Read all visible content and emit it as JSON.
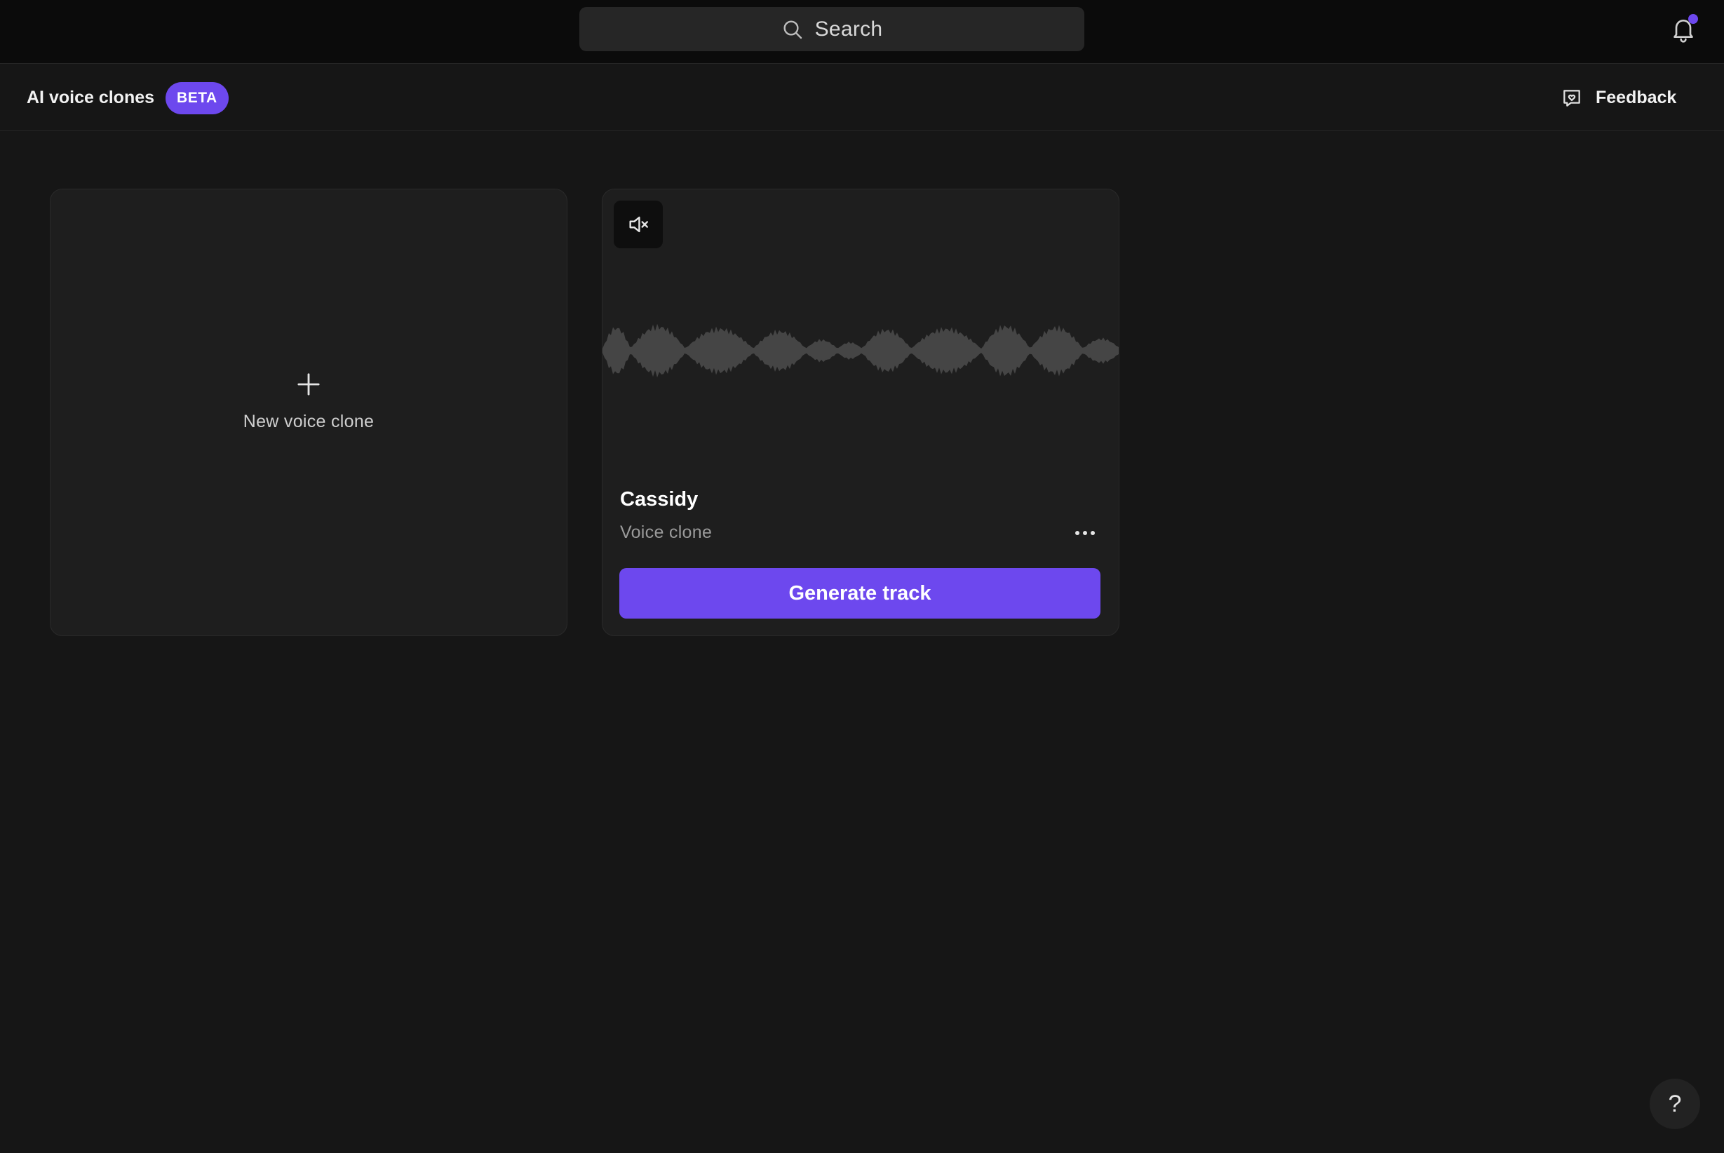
{
  "topbar": {
    "search_label": "Search",
    "search_icon": "magnifier-icon",
    "notification_icon": "bell-icon",
    "notification_dot_color": "#6d48ee"
  },
  "header": {
    "title": "AI voice clones",
    "badge": "BETA",
    "feedback_label": "Feedback",
    "feedback_icon": "chat-heart-icon"
  },
  "cards": {
    "new_clone": {
      "label": "New voice clone",
      "icon": "plus-icon"
    },
    "voices": [
      {
        "name": "Cassidy",
        "type": "Voice clone",
        "mute_icon": "speaker-muted-icon",
        "more_icon": "ellipsis-icon",
        "action_label": "Generate track"
      }
    ]
  },
  "help": {
    "label": "?"
  },
  "colors": {
    "accent": "#6d48ee",
    "background": "#161616",
    "card": "#1e1e1e",
    "waveform": "#454545"
  }
}
